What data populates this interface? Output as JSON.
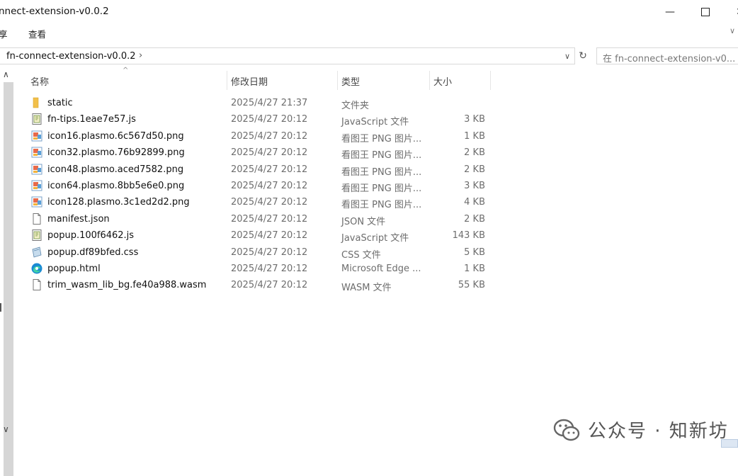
{
  "window": {
    "title": "nnect-extension-v0.0.2",
    "minimize": "—",
    "close": "✕"
  },
  "ribbon": {
    "tabs": [
      "享",
      "查看"
    ],
    "expand": "∨"
  },
  "address": {
    "path": "fn-connect-extension-v0.0.2",
    "separator": "›",
    "dropdown": "∨",
    "refresh": "↻",
    "search_placeholder": "在 fn-connect-extension-v0..."
  },
  "columns": {
    "name": "名称",
    "date": "修改日期",
    "type": "类型",
    "size": "大小",
    "sort_indicator": "^"
  },
  "files": [
    {
      "name": "static",
      "date": "2025/4/27 21:37",
      "type": "文件夹",
      "size": "",
      "icon": "folder-icon"
    },
    {
      "name": "fn-tips.1eae7e57.js",
      "date": "2025/4/27 20:12",
      "type": "JavaScript 文件",
      "size": "3 KB",
      "icon": "js-file-icon"
    },
    {
      "name": "icon16.plasmo.6c567d50.png",
      "date": "2025/4/27 20:12",
      "type": "看图王 PNG 图片...",
      "size": "1 KB",
      "icon": "png-image-icon"
    },
    {
      "name": "icon32.plasmo.76b92899.png",
      "date": "2025/4/27 20:12",
      "type": "看图王 PNG 图片...",
      "size": "2 KB",
      "icon": "png-image-icon"
    },
    {
      "name": "icon48.plasmo.aced7582.png",
      "date": "2025/4/27 20:12",
      "type": "看图王 PNG 图片...",
      "size": "2 KB",
      "icon": "png-image-icon"
    },
    {
      "name": "icon64.plasmo.8bb5e6e0.png",
      "date": "2025/4/27 20:12",
      "type": "看图王 PNG 图片...",
      "size": "3 KB",
      "icon": "png-image-icon"
    },
    {
      "name": "icon128.plasmo.3c1ed2d2.png",
      "date": "2025/4/27 20:12",
      "type": "看图王 PNG 图片...",
      "size": "4 KB",
      "icon": "png-image-icon"
    },
    {
      "name": "manifest.json",
      "date": "2025/4/27 20:12",
      "type": "JSON 文件",
      "size": "2 KB",
      "icon": "blank-file-icon"
    },
    {
      "name": "popup.100f6462.js",
      "date": "2025/4/27 20:12",
      "type": "JavaScript 文件",
      "size": "143 KB",
      "icon": "js-file-icon"
    },
    {
      "name": "popup.df89bfed.css",
      "date": "2025/4/27 20:12",
      "type": "CSS 文件",
      "size": "5 KB",
      "icon": "css-file-icon"
    },
    {
      "name": "popup.html",
      "date": "2025/4/27 20:12",
      "type": "Microsoft Edge ...",
      "size": "1 KB",
      "icon": "edge-icon"
    },
    {
      "name": "trim_wasm_lib_bg.fe40a988.wasm",
      "date": "2025/4/27 20:12",
      "type": "WASM 文件",
      "size": "55 KB",
      "icon": "blank-file-icon"
    }
  ],
  "watermark": {
    "text": "公众号 · 知新坊"
  },
  "colors": {
    "folder": "#f2c04a",
    "scrollbar": "#d6d6d6",
    "muted_text": "#6d6d6d"
  }
}
